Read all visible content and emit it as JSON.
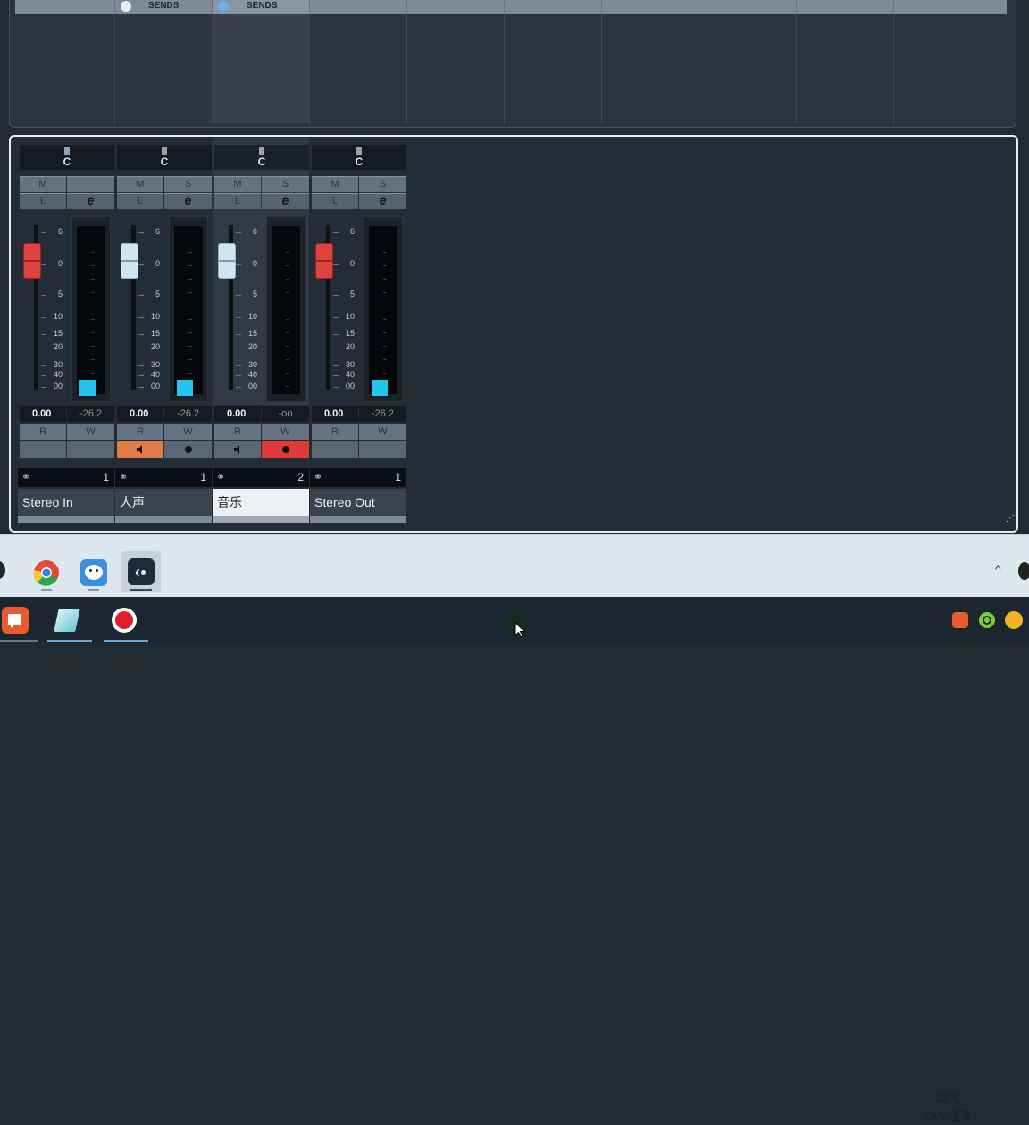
{
  "sends": {
    "label_1": "SENDS",
    "label_2": "SENDS",
    "dot_color_1": "#e9eef2",
    "dot_color_2": "#6aaef0"
  },
  "mixer": {
    "scale_labels": [
      "6",
      "0",
      "5",
      "10",
      "15",
      "20",
      "30",
      "40",
      "00"
    ],
    "channels": [
      {
        "pan": "C",
        "mute": "M",
        "solo": "",
        "listen": "L",
        "edit": "e",
        "volume": "0.00",
        "peak": "-26.2",
        "read": "R",
        "write": "W",
        "read_state": "",
        "write_state": "",
        "number": "1",
        "name": "Stereo In",
        "fader_color": "#e0433f"
      },
      {
        "pan": "C",
        "mute": "M",
        "solo": "S",
        "listen": "L",
        "edit": "e",
        "volume": "0.00",
        "peak": "-26.2",
        "read": "R",
        "write": "W",
        "read_state": "speaker-icon",
        "write_state": "record-dot-icon",
        "number": "1",
        "name": "人声",
        "fader_color": "#cfe6f2"
      },
      {
        "pan": "C",
        "mute": "M",
        "solo": "S",
        "listen": "L",
        "edit": "e",
        "volume": "0.00",
        "peak": "-oo",
        "read": "R",
        "write": "W",
        "read_state": "speaker-icon",
        "write_state": "record-dot-icon",
        "number": "2",
        "name": "音乐",
        "fader_color": "#cfe6f2"
      },
      {
        "pan": "C",
        "mute": "M",
        "solo": "S",
        "listen": "L",
        "edit": "e",
        "volume": "0.00",
        "peak": "-26.2",
        "read": "R",
        "write": "W",
        "read_state": "",
        "write_state": "",
        "number": "1",
        "name": "Stereo Out",
        "fader_color": "#e0433f"
      }
    ]
  },
  "system": {
    "temperature": "32℃",
    "temp_label": "CPU温度",
    "tray_arrow": "^"
  },
  "colors": {
    "read_active": "#e07b45",
    "write_active": "#e0393a",
    "meter": "#24c4f0"
  }
}
